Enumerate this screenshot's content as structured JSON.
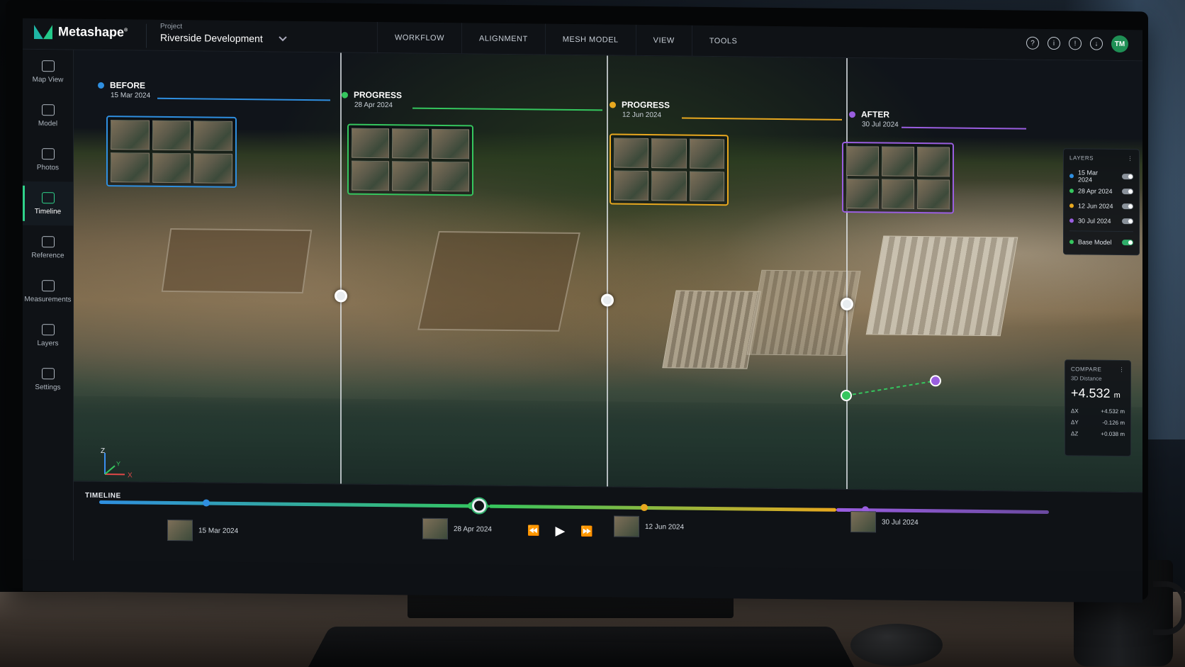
{
  "app": {
    "name": "Metashape",
    "trademark": "®",
    "project_label": "Project",
    "project_name": "Riverside Development"
  },
  "menu": [
    "WORKFLOW",
    "ALIGNMENT",
    "MESH MODEL",
    "VIEW",
    "TOOLS"
  ],
  "top_icons": [
    "help-icon",
    "info-icon",
    "notifications-icon",
    "download-icon"
  ],
  "user_initials": "TM",
  "sidebar": [
    {
      "label": "Map View",
      "icon": "map-icon"
    },
    {
      "label": "Model",
      "icon": "model-icon"
    },
    {
      "label": "Photos",
      "icon": "photos-icon"
    },
    {
      "label": "Timeline",
      "icon": "timeline-icon",
      "active": true
    },
    {
      "label": "Reference",
      "icon": "reference-icon"
    },
    {
      "label": "Measurements",
      "icon": "measurements-icon"
    },
    {
      "label": "Layers",
      "icon": "layers-icon"
    },
    {
      "label": "Settings",
      "icon": "settings-icon"
    }
  ],
  "phases": [
    {
      "title": "BEFORE",
      "date": "15 Mar 2024",
      "color": "#2f8fe0"
    },
    {
      "title": "PROGRESS",
      "date": "28 Apr 2024",
      "color": "#35c65e"
    },
    {
      "title": "PROGRESS",
      "date": "12 Jun 2024",
      "color": "#e8a81f"
    },
    {
      "title": "AFTER",
      "date": "30 Jul 2024",
      "color": "#9a5ee0"
    }
  ],
  "layers_panel": {
    "title": "LAYERS",
    "items": [
      {
        "label": "15 Mar 2024",
        "color": "#2f8fe0",
        "on": false
      },
      {
        "label": "28 Apr 2024",
        "color": "#35c65e",
        "on": false
      },
      {
        "label": "12 Jun 2024",
        "color": "#e8a81f",
        "on": false
      },
      {
        "label": "30 Jul 2024",
        "color": "#9a5ee0",
        "on": false
      }
    ],
    "base_model": {
      "label": "Base Model",
      "color": "#35c65e",
      "on": true
    }
  },
  "compare_panel": {
    "title": "COMPARE",
    "metric_label": "3D Distance",
    "value": "+4.532",
    "unit": "m",
    "rows": [
      {
        "label": "ΔX",
        "value": "+4.532 m"
      },
      {
        "label": "ΔY",
        "value": "-0.126 m"
      },
      {
        "label": "ΔZ",
        "value": "+0.038 m"
      }
    ]
  },
  "axes": {
    "x": "X",
    "y": "Y",
    "z": "Z"
  },
  "timeline": {
    "label": "TIMELINE",
    "current_position_fraction": 0.4,
    "entries": [
      "15 Mar 2024",
      "28 Apr 2024",
      "12 Jun 2024",
      "30 Jul 2024"
    ],
    "controls": {
      "rewind": "⏪",
      "play": "▶",
      "forward": "⏩"
    }
  }
}
